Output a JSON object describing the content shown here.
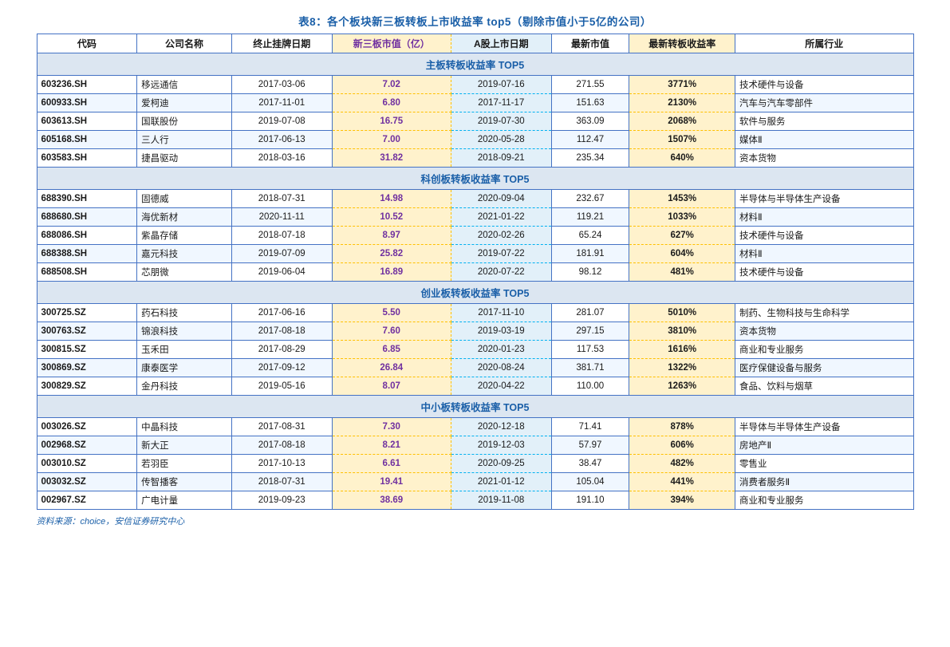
{
  "title": "表8：各个板块新三板转板上市收益率 top5（剔除市值小于5亿的公司）",
  "headers": {
    "code": "代码",
    "company": "公司名称",
    "end_date": "终止挂牌日期",
    "new3_val": "新三板市值（亿）",
    "a_date": "A股上市日期",
    "latest_val": "最新市值",
    "latest_rate": "最新转板收益率",
    "industry": "所属行业"
  },
  "sections": [
    {
      "title": "主板转板收益率 TOP5",
      "rows": [
        {
          "code": "603236.SH",
          "company": "移远通信",
          "end_date": "2017-03-06",
          "new3_val": "7.02",
          "a_date": "2019-07-16",
          "latest_val": "271.55",
          "latest_rate": "3771%",
          "industry": "技术硬件与设备"
        },
        {
          "code": "600933.SH",
          "company": "爱柯迪",
          "end_date": "2017-11-01",
          "new3_val": "6.80",
          "a_date": "2017-11-17",
          "latest_val": "151.63",
          "latest_rate": "2130%",
          "industry": "汽车与汽车零部件"
        },
        {
          "code": "603613.SH",
          "company": "国联股份",
          "end_date": "2019-07-08",
          "new3_val": "16.75",
          "a_date": "2019-07-30",
          "latest_val": "363.09",
          "latest_rate": "2068%",
          "industry": "软件与服务"
        },
        {
          "code": "605168.SH",
          "company": "三人行",
          "end_date": "2017-06-13",
          "new3_val": "7.00",
          "a_date": "2020-05-28",
          "latest_val": "112.47",
          "latest_rate": "1507%",
          "industry": "媒体Ⅱ"
        },
        {
          "code": "603583.SH",
          "company": "捷昌驱动",
          "end_date": "2018-03-16",
          "new3_val": "31.82",
          "a_date": "2018-09-21",
          "latest_val": "235.34",
          "latest_rate": "640%",
          "industry": "资本货物"
        }
      ]
    },
    {
      "title": "科创板转板收益率 TOP5",
      "rows": [
        {
          "code": "688390.SH",
          "company": "固德威",
          "end_date": "2018-07-31",
          "new3_val": "14.98",
          "a_date": "2020-09-04",
          "latest_val": "232.67",
          "latest_rate": "1453%",
          "industry": "半导体与半导体生产设备"
        },
        {
          "code": "688680.SH",
          "company": "海优新材",
          "end_date": "2020-11-11",
          "new3_val": "10.52",
          "a_date": "2021-01-22",
          "latest_val": "119.21",
          "latest_rate": "1033%",
          "industry": "材料Ⅱ"
        },
        {
          "code": "688086.SH",
          "company": "紫晶存储",
          "end_date": "2018-07-18",
          "new3_val": "8.97",
          "a_date": "2020-02-26",
          "latest_val": "65.24",
          "latest_rate": "627%",
          "industry": "技术硬件与设备"
        },
        {
          "code": "688388.SH",
          "company": "嘉元科技",
          "end_date": "2019-07-09",
          "new3_val": "25.82",
          "a_date": "2019-07-22",
          "latest_val": "181.91",
          "latest_rate": "604%",
          "industry": "材料Ⅱ"
        },
        {
          "code": "688508.SH",
          "company": "芯朋微",
          "end_date": "2019-06-04",
          "new3_val": "16.89",
          "a_date": "2020-07-22",
          "latest_val": "98.12",
          "latest_rate": "481%",
          "industry": "技术硬件与设备"
        }
      ]
    },
    {
      "title": "创业板转板收益率 TOP5",
      "rows": [
        {
          "code": "300725.SZ",
          "company": "药石科技",
          "end_date": "2017-06-16",
          "new3_val": "5.50",
          "a_date": "2017-11-10",
          "latest_val": "281.07",
          "latest_rate": "5010%",
          "industry": "制药、生物科技与生命科学"
        },
        {
          "code": "300763.SZ",
          "company": "锦浪科技",
          "end_date": "2017-08-18",
          "new3_val": "7.60",
          "a_date": "2019-03-19",
          "latest_val": "297.15",
          "latest_rate": "3810%",
          "industry": "资本货物"
        },
        {
          "code": "300815.SZ",
          "company": "玉禾田",
          "end_date": "2017-08-29",
          "new3_val": "6.85",
          "a_date": "2020-01-23",
          "latest_val": "117.53",
          "latest_rate": "1616%",
          "industry": "商业和专业服务"
        },
        {
          "code": "300869.SZ",
          "company": "康泰医学",
          "end_date": "2017-09-12",
          "new3_val": "26.84",
          "a_date": "2020-08-24",
          "latest_val": "381.71",
          "latest_rate": "1322%",
          "industry": "医疗保健设备与服务"
        },
        {
          "code": "300829.SZ",
          "company": "金丹科技",
          "end_date": "2019-05-16",
          "new3_val": "8.07",
          "a_date": "2020-04-22",
          "latest_val": "110.00",
          "latest_rate": "1263%",
          "industry": "食品、饮料与烟草"
        }
      ]
    },
    {
      "title": "中小板转板收益率 TOP5",
      "rows": [
        {
          "code": "003026.SZ",
          "company": "中晶科技",
          "end_date": "2017-08-31",
          "new3_val": "7.30",
          "a_date": "2020-12-18",
          "latest_val": "71.41",
          "latest_rate": "878%",
          "industry": "半导体与半导体生产设备"
        },
        {
          "code": "002968.SZ",
          "company": "新大正",
          "end_date": "2017-08-18",
          "new3_val": "8.21",
          "a_date": "2019-12-03",
          "latest_val": "57.97",
          "latest_rate": "606%",
          "industry": "房地产Ⅱ"
        },
        {
          "code": "003010.SZ",
          "company": "若羽臣",
          "end_date": "2017-10-13",
          "new3_val": "6.61",
          "a_date": "2020-09-25",
          "latest_val": "38.47",
          "latest_rate": "482%",
          "industry": "零售业"
        },
        {
          "code": "003032.SZ",
          "company": "传智播客",
          "end_date": "2018-07-31",
          "new3_val": "19.41",
          "a_date": "2021-01-12",
          "latest_val": "105.04",
          "latest_rate": "441%",
          "industry": "消费者服务Ⅱ"
        },
        {
          "code": "002967.SZ",
          "company": "广电计量",
          "end_date": "2019-09-23",
          "new3_val": "38.69",
          "a_date": "2019-11-08",
          "latest_val": "191.10",
          "latest_rate": "394%",
          "industry": "商业和专业服务"
        }
      ]
    }
  ],
  "source": "资料来源：choice，安信证券研究中心"
}
